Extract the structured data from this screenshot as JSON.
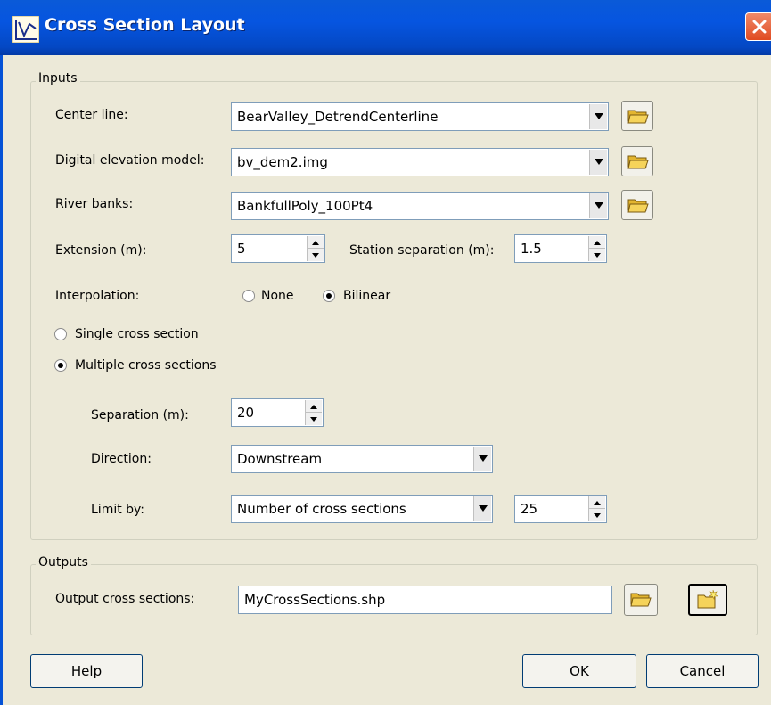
{
  "window": {
    "title": "Cross Section Layout"
  },
  "inputs": {
    "legend": "Inputs",
    "center_line": {
      "label": "Center line:",
      "value": "BearValley_DetrendCenterline"
    },
    "dem": {
      "label": "Digital elevation model:",
      "value": "bv_dem2.img"
    },
    "river_banks": {
      "label": "River banks:",
      "value": "BankfullPoly_100Pt4"
    },
    "extension": {
      "label": "Extension (m):",
      "value": "5"
    },
    "station_separation": {
      "label": "Station separation (m):",
      "value": "1.5"
    },
    "interpolation": {
      "label": "Interpolation:",
      "options": [
        "None",
        "Bilinear"
      ],
      "selected": "Bilinear"
    },
    "mode_options": [
      "Single cross section",
      "Multiple cross sections"
    ],
    "mode_selected": "Multiple cross sections",
    "separation": {
      "label": "Separation (m):",
      "value": "20"
    },
    "direction": {
      "label": "Direction:",
      "value": "Downstream"
    },
    "limit_by": {
      "label": "Limit by:",
      "value": "Number of cross sections",
      "count": "25"
    }
  },
  "outputs": {
    "legend": "Outputs",
    "output_cross_sections": {
      "label": "Output cross sections:",
      "value": "MyCrossSections.shp"
    }
  },
  "buttons": {
    "help": "Help",
    "ok": "OK",
    "cancel": "Cancel"
  },
  "colors": {
    "titlebar": "#0655e0",
    "dialog": "#ece9d8",
    "field_border": "#7f9db9",
    "folder_icon": "#f5d35a"
  },
  "icons": {
    "title": "chart-icon",
    "close": "close-icon",
    "browse": "folder-open-icon",
    "new": "new-folder-icon"
  }
}
